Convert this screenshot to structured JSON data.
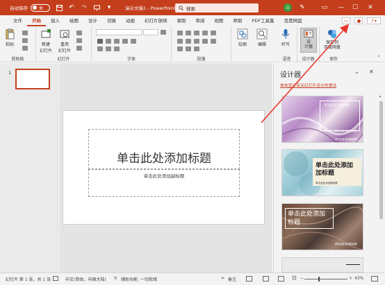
{
  "titlebar": {
    "autosave_label": "自动保存",
    "toggle_state": "关",
    "title": "演示文稿1 - PowerPoint",
    "search_placeholder": "搜索",
    "avatar_letter": "G"
  },
  "tabs": [
    "文件",
    "开始",
    "插入",
    "绘图",
    "设计",
    "切换",
    "动画",
    "幻灯片放映",
    "录制",
    "审阅",
    "视图",
    "帮助",
    "PDF工具集",
    "百度网盘"
  ],
  "active_tab": "开始",
  "ribbon": {
    "paste_label": "粘贴",
    "new_slide_label": "新建\n幻灯片",
    "reuse_slide_label": "重用\n幻灯片",
    "drawing_label": "绘图",
    "edit_label": "编辑",
    "dictate_label": "听写",
    "designer_label": "设\n计器",
    "save_to_baidu_label": "保存到\n百度网盘",
    "groups": {
      "clipboard": "剪贴板",
      "slides": "幻灯片",
      "font": "字体",
      "paragraph": "段落",
      "voice": "语音",
      "designer": "设计器",
      "save": "保存"
    }
  },
  "thumbnails": [
    {
      "num": "1"
    }
  ],
  "slide": {
    "title_placeholder": "单击此处添加标题",
    "subtitle_placeholder": "单击此处添加副标题"
  },
  "designer": {
    "title": "设计器",
    "link": "单击显示有关幻灯片设计的想法",
    "cards": [
      {
        "title": "单击此处添加标题",
        "subtitle": "单击此处添加副标题",
        "footer": "单击此处添加副标题"
      },
      {
        "title": "单击此处添加\n加标题",
        "subtitle": "单击此处添加副标题"
      },
      {
        "title": "单击此处添加\n标题",
        "subtitle": "单击此处添加副标题"
      }
    ]
  },
  "statusbar": {
    "slide_info": "幻灯片 第 1 张，共 1 张",
    "language": "中文(简体，中国大陆)",
    "accessibility": "辅助功能: 一切就绪",
    "notes": "备注",
    "zoom": "43%"
  },
  "colors": {
    "accent": "#c43e1c",
    "ribbon_bg": "#f3f3f3",
    "arrow": "#e8382b"
  }
}
